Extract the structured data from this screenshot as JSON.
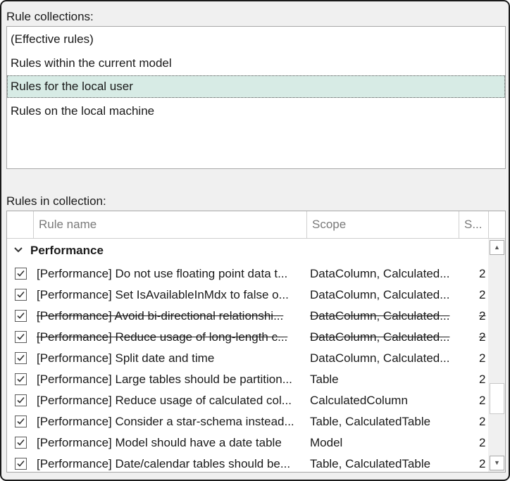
{
  "rule_collections": {
    "label": "Rule collections:",
    "items": [
      {
        "label": "(Effective rules)",
        "selected": false
      },
      {
        "label": "Rules within the current model",
        "selected": false
      },
      {
        "label": "Rules for the local user",
        "selected": true
      },
      {
        "label": "Rules on the local machine",
        "selected": false
      }
    ]
  },
  "rules_in_collection": {
    "label": "Rules in collection:",
    "columns": {
      "name": "Rule name",
      "scope": "Scope",
      "severity": "S..."
    },
    "group": {
      "name": "Performance",
      "expanded": true
    },
    "rows": [
      {
        "name": "[Performance] Do not use floating point data t...",
        "scope": "DataColumn, Calculated...",
        "severity": "2",
        "checked": true,
        "disabled": false
      },
      {
        "name": "[Performance] Set IsAvailableInMdx to false o...",
        "scope": "DataColumn, Calculated...",
        "severity": "2",
        "checked": true,
        "disabled": false
      },
      {
        "name": "[Performance] Avoid bi-directional relationshi...",
        "scope": "DataColumn, Calculated...",
        "severity": "2",
        "checked": true,
        "disabled": true
      },
      {
        "name": "[Performance] Reduce usage of long-length c...",
        "scope": "DataColumn, Calculated...",
        "severity": "2",
        "checked": true,
        "disabled": true
      },
      {
        "name": "[Performance] Split date and time",
        "scope": "DataColumn, Calculated...",
        "severity": "2",
        "checked": true,
        "disabled": false
      },
      {
        "name": "[Performance] Large tables should be partition...",
        "scope": "Table",
        "severity": "2",
        "checked": true,
        "disabled": false
      },
      {
        "name": "[Performance] Reduce usage of calculated col...",
        "scope": "CalculatedColumn",
        "severity": "2",
        "checked": true,
        "disabled": false
      },
      {
        "name": "[Performance] Consider a star-schema instead...",
        "scope": "Table, CalculatedTable",
        "severity": "2",
        "checked": true,
        "disabled": false
      },
      {
        "name": "[Performance] Model should have a date table",
        "scope": "Model",
        "severity": "2",
        "checked": true,
        "disabled": false
      },
      {
        "name": "[Performance] Date/calendar tables should be...",
        "scope": "Table, CalculatedTable",
        "severity": "2",
        "checked": true,
        "disabled": false
      }
    ],
    "scrollbar": {
      "up_icon": "triangle-up",
      "down_icon": "triangle-down"
    }
  },
  "icons": {
    "check": "check-icon",
    "chevron": "chevron-down-icon"
  },
  "colors": {
    "selected_bg": "#d7ebe5",
    "window_bg": "#f0f0f0"
  }
}
